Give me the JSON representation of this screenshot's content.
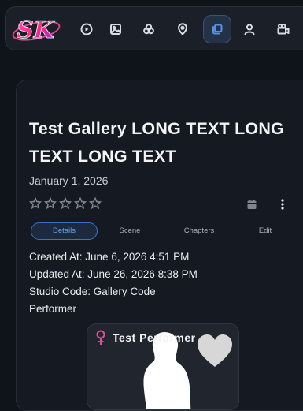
{
  "logo_text": "SK",
  "nav": {
    "items": [
      {
        "icon": "play-circle-icon"
      },
      {
        "icon": "image-icon"
      },
      {
        "icon": "groups-icon"
      },
      {
        "icon": "location-pin-icon"
      },
      {
        "icon": "galleries-icon",
        "active": true
      },
      {
        "icon": "person-icon"
      },
      {
        "icon": "studio-camera-icon"
      }
    ]
  },
  "gallery": {
    "title": "Test Gallery LONG TEXT LONG TEXT LONG TEXT",
    "date": "January 1, 2026",
    "rating": 0,
    "tabs": [
      "Details",
      "Scene",
      "Chapters",
      "Edit"
    ],
    "active_tab": "Details",
    "created": "Created At: June 6, 2026 4:51 PM",
    "updated": "Updated At: June 26, 2026 8:38 PM",
    "studio_code": "Studio Code: Gallery Code",
    "performer_heading": "Performer"
  },
  "performer": {
    "name": "Test Performer"
  },
  "colors": {
    "accent": "#3c72c4",
    "female": "#e04c9a"
  }
}
